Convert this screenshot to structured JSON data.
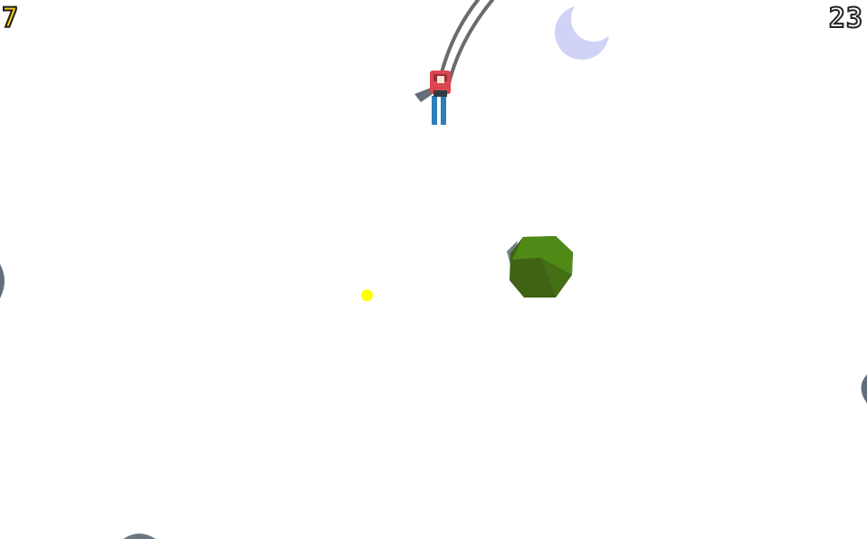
{
  "hud": {
    "coin_count": "7",
    "score": "23"
  },
  "icons": {
    "moon": "crescent-moon-icon",
    "coin": "yellow-coin-dot"
  },
  "colors": {
    "background": "#ffffff",
    "coin_text": "#f6c915",
    "score_text": "#ffffff",
    "text_outline": "#1e1e1e",
    "moon": "#d0d3f6",
    "tree_light": "#4f8a17",
    "tree_dark": "#3a5e12",
    "skier_jacket": "#d9474f",
    "skier_legs": "#2e7fb8",
    "ski_tracks": "#6b6b6b",
    "rock_shadow": "#3c4a5a",
    "coin": "#ffff00"
  }
}
